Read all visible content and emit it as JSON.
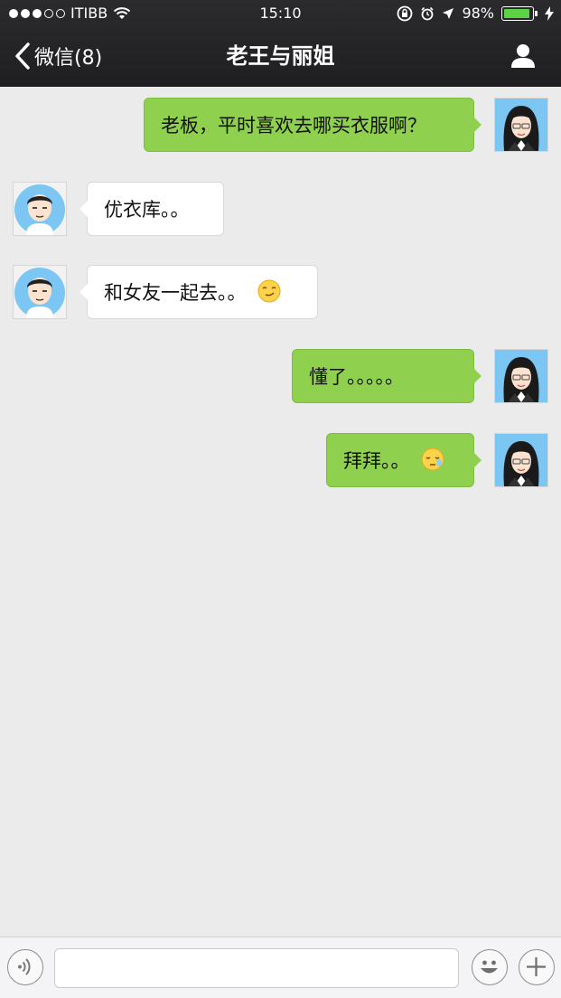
{
  "status_bar": {
    "carrier": "ITIBB",
    "time": "15:10",
    "battery": "98%",
    "battery_level": 0.98,
    "signal_bars": 3,
    "signal_total": 5
  },
  "nav": {
    "back_label": "微信(8)",
    "title": "老王与丽姐"
  },
  "messages": [
    {
      "side": "mine",
      "text": "老板，平时喜欢去哪买衣服啊？"
    },
    {
      "side": "theirs",
      "text": "优衣库。。"
    },
    {
      "side": "theirs",
      "text": "和女友一起去。。",
      "emoji": "smirk-emoji"
    },
    {
      "side": "mine",
      "text": "懂了。。。。。"
    },
    {
      "side": "mine",
      "text": "拜拜。。",
      "emoji": "sleepy-emoji"
    }
  ],
  "input": {
    "value": "",
    "placeholder": ""
  },
  "colors": {
    "bar": "#252527",
    "my_bubble": "#8fd14f",
    "their_bubble": "#ffffff",
    "background": "#ebebeb",
    "battery": "#5cd245"
  },
  "icons": {
    "back": "chevron-left-icon",
    "profile": "person-icon",
    "voice": "voice-icon",
    "emoji": "smiley-icon",
    "more": "plus-icon"
  }
}
